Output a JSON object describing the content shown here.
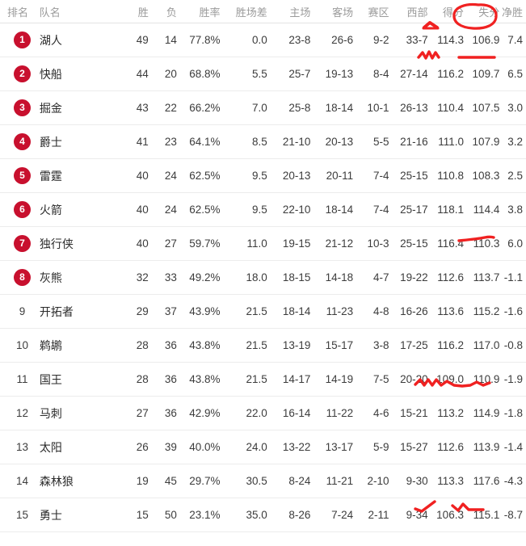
{
  "table": {
    "columns": [
      {
        "key": "rank",
        "label": "排名",
        "name": "col-rank"
      },
      {
        "key": "team",
        "label": "队名",
        "name": "col-team"
      },
      {
        "key": "w",
        "label": "胜",
        "name": "col-wins"
      },
      {
        "key": "l",
        "label": "负",
        "name": "col-losses"
      },
      {
        "key": "pct",
        "label": "胜率",
        "name": "col-win-pct"
      },
      {
        "key": "gb",
        "label": "胜场差",
        "name": "col-games-behind"
      },
      {
        "key": "home",
        "label": "主场",
        "name": "col-home"
      },
      {
        "key": "away",
        "label": "客场",
        "name": "col-away"
      },
      {
        "key": "div",
        "label": "赛区",
        "name": "col-division"
      },
      {
        "key": "conf",
        "label": "西部",
        "name": "col-conference"
      },
      {
        "key": "pf",
        "label": "得分",
        "name": "col-points-for"
      },
      {
        "key": "pa",
        "label": "失分",
        "name": "col-points-against"
      },
      {
        "key": "diff",
        "label": "净胜",
        "name": "col-point-diff"
      }
    ],
    "rows": [
      {
        "rank": "1",
        "badge": true,
        "team": "湖人",
        "w": "49",
        "l": "14",
        "pct": "77.8%",
        "gb": "0.0",
        "home": "23-8",
        "away": "26-6",
        "div": "9-2",
        "conf": "33-7",
        "pf": "114.3",
        "pa": "106.9",
        "diff": "7.4"
      },
      {
        "rank": "2",
        "badge": true,
        "team": "快船",
        "w": "44",
        "l": "20",
        "pct": "68.8%",
        "gb": "5.5",
        "home": "25-7",
        "away": "19-13",
        "div": "8-4",
        "conf": "27-14",
        "pf": "116.2",
        "pa": "109.7",
        "diff": "6.5"
      },
      {
        "rank": "3",
        "badge": true,
        "team": "掘金",
        "w": "43",
        "l": "22",
        "pct": "66.2%",
        "gb": "7.0",
        "home": "25-8",
        "away": "18-14",
        "div": "10-1",
        "conf": "26-13",
        "pf": "110.4",
        "pa": "107.5",
        "diff": "3.0"
      },
      {
        "rank": "4",
        "badge": true,
        "team": "爵士",
        "w": "41",
        "l": "23",
        "pct": "64.1%",
        "gb": "8.5",
        "home": "21-10",
        "away": "20-13",
        "div": "5-5",
        "conf": "21-16",
        "pf": "111.0",
        "pa": "107.9",
        "diff": "3.2"
      },
      {
        "rank": "5",
        "badge": true,
        "team": "雷霆",
        "w": "40",
        "l": "24",
        "pct": "62.5%",
        "gb": "9.5",
        "home": "20-13",
        "away": "20-11",
        "div": "7-4",
        "conf": "25-15",
        "pf": "110.8",
        "pa": "108.3",
        "diff": "2.5"
      },
      {
        "rank": "6",
        "badge": true,
        "team": "火箭",
        "w": "40",
        "l": "24",
        "pct": "62.5%",
        "gb": "9.5",
        "home": "22-10",
        "away": "18-14",
        "div": "7-4",
        "conf": "25-17",
        "pf": "118.1",
        "pa": "114.4",
        "diff": "3.8"
      },
      {
        "rank": "7",
        "badge": true,
        "team": "独行侠",
        "w": "40",
        "l": "27",
        "pct": "59.7%",
        "gb": "11.0",
        "home": "19-15",
        "away": "21-12",
        "div": "10-3",
        "conf": "25-15",
        "pf": "116.4",
        "pa": "110.3",
        "diff": "6.0"
      },
      {
        "rank": "8",
        "badge": true,
        "team": "灰熊",
        "w": "32",
        "l": "33",
        "pct": "49.2%",
        "gb": "18.0",
        "home": "18-15",
        "away": "14-18",
        "div": "4-7",
        "conf": "19-22",
        "pf": "112.6",
        "pa": "113.7",
        "diff": "-1.1"
      },
      {
        "rank": "9",
        "badge": false,
        "team": "开拓者",
        "w": "29",
        "l": "37",
        "pct": "43.9%",
        "gb": "21.5",
        "home": "18-14",
        "away": "11-23",
        "div": "4-8",
        "conf": "16-26",
        "pf": "113.6",
        "pa": "115.2",
        "diff": "-1.6"
      },
      {
        "rank": "10",
        "badge": false,
        "team": "鹈鹕",
        "w": "28",
        "l": "36",
        "pct": "43.8%",
        "gb": "21.5",
        "home": "13-19",
        "away": "15-17",
        "div": "3-8",
        "conf": "17-25",
        "pf": "116.2",
        "pa": "117.0",
        "diff": "-0.8"
      },
      {
        "rank": "11",
        "badge": false,
        "team": "国王",
        "w": "28",
        "l": "36",
        "pct": "43.8%",
        "gb": "21.5",
        "home": "14-17",
        "away": "14-19",
        "div": "7-5",
        "conf": "20-20",
        "pf": "109.0",
        "pa": "110.9",
        "diff": "-1.9"
      },
      {
        "rank": "12",
        "badge": false,
        "team": "马刺",
        "w": "27",
        "l": "36",
        "pct": "42.9%",
        "gb": "22.0",
        "home": "16-14",
        "away": "11-22",
        "div": "4-6",
        "conf": "15-21",
        "pf": "113.2",
        "pa": "114.9",
        "diff": "-1.8"
      },
      {
        "rank": "13",
        "badge": false,
        "team": "太阳",
        "w": "26",
        "l": "39",
        "pct": "40.0%",
        "gb": "24.0",
        "home": "13-22",
        "away": "13-17",
        "div": "5-9",
        "conf": "15-27",
        "pf": "112.6",
        "pa": "113.9",
        "diff": "-1.4"
      },
      {
        "rank": "14",
        "badge": false,
        "team": "森林狼",
        "w": "19",
        "l": "45",
        "pct": "29.7%",
        "gb": "30.5",
        "home": "8-24",
        "away": "11-21",
        "div": "2-10",
        "conf": "9-30",
        "pf": "113.3",
        "pa": "117.6",
        "diff": "-4.3"
      },
      {
        "rank": "15",
        "badge": false,
        "team": "勇士",
        "w": "15",
        "l": "50",
        "pct": "23.1%",
        "gb": "35.0",
        "home": "8-26",
        "away": "7-24",
        "div": "2-11",
        "conf": "9-34",
        "pf": "106.3",
        "pa": "115.1",
        "diff": "-8.7"
      }
    ]
  },
  "annotations": {
    "color": "#f02121",
    "marks": [
      {
        "name": "circle-around-points-against-header",
        "shape": "ellipse",
        "target": "失分"
      },
      {
        "name": "caret-under-points-for-header",
        "shape": "caret",
        "target": "得分"
      },
      {
        "name": "squiggle-under-lakers-points-for",
        "shape": "zigzag",
        "target": "114.3"
      },
      {
        "name": "underline-under-lakers-points-against",
        "shape": "line",
        "target": "106.9"
      },
      {
        "name": "underline-under-rockets-points-against",
        "shape": "line",
        "target": "114.4"
      },
      {
        "name": "squiggle-under-pelicans-scores",
        "shape": "wave",
        "target": "116.2 117.0"
      },
      {
        "name": "squiggle-under-wolves-points-for",
        "shape": "check",
        "target": "113.3"
      },
      {
        "name": "squiggle-under-wolves-points-against",
        "shape": "check",
        "target": "117.6"
      }
    ]
  },
  "theme": {
    "badge_color": "#c8102e",
    "annotation_color": "#f02121",
    "header_text_color": "#9b9b9b",
    "row_border_color": "#ececec"
  }
}
